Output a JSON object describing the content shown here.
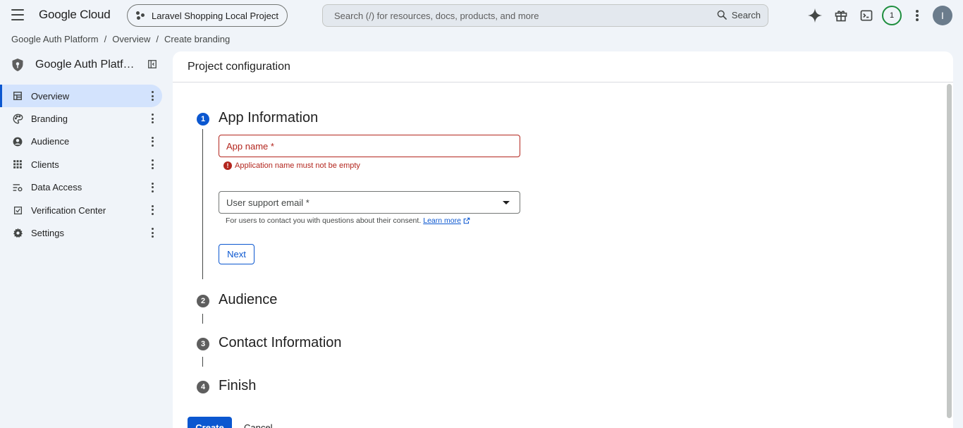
{
  "header": {
    "logo": "Google Cloud",
    "project": "Laravel Shopping Local Project",
    "search_placeholder": "Search (/) for resources, docs, products, and more",
    "search_button": "Search",
    "notification_count": "1",
    "avatar_initial": "I"
  },
  "breadcrumb": [
    "Google Auth Platform",
    "Overview",
    "Create branding"
  ],
  "sidebar": {
    "title": "Google Auth Platf…",
    "items": [
      {
        "label": "Overview",
        "icon": "dashboard-icon"
      },
      {
        "label": "Branding",
        "icon": "palette-icon"
      },
      {
        "label": "Audience",
        "icon": "person-icon"
      },
      {
        "label": "Clients",
        "icon": "apps-grid-icon"
      },
      {
        "label": "Data Access",
        "icon": "filter-settings-icon"
      },
      {
        "label": "Verification Center",
        "icon": "checkbox-icon"
      },
      {
        "label": "Settings",
        "icon": "gear-icon"
      }
    ]
  },
  "main": {
    "title": "Project configuration",
    "steps": [
      {
        "num": "1",
        "title": "App Information"
      },
      {
        "num": "2",
        "title": "Audience"
      },
      {
        "num": "3",
        "title": "Contact Information"
      },
      {
        "num": "4",
        "title": "Finish"
      }
    ],
    "app_name_label": "App name *",
    "app_name_error": "Application name must not be empty",
    "email_label": "User support email *",
    "email_helper": "For users to contact you with questions about their consent.",
    "learn_more": "Learn more",
    "next_button": "Next",
    "create_button": "Create",
    "cancel_button": "Cancel"
  },
  "colors": {
    "accent": "#0b57d0",
    "error": "#b3261e",
    "active_nav": "#d3e3fd",
    "background": "#f0f4f9"
  }
}
